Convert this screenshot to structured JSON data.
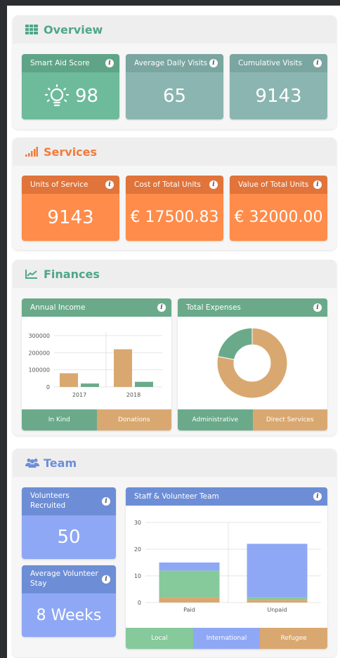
{
  "overview": {
    "title": "Overview",
    "cards": [
      {
        "label": "Smart Aid Score",
        "value": "98"
      },
      {
        "label": "Average Daily Visits",
        "value": "65"
      },
      {
        "label": "Cumulative Visits",
        "value": "9143"
      }
    ]
  },
  "services": {
    "title": "Services",
    "cards": [
      {
        "label": "Units of Service",
        "value": "9143"
      },
      {
        "label": "Cost of Total Units",
        "value": "€ 17500.83"
      },
      {
        "label": "Value of Total Units",
        "value": "€ 32000.00"
      }
    ]
  },
  "finances": {
    "title": "Finances",
    "income_label": "Annual Income",
    "expenses_label": "Total Expenses",
    "income_legend": [
      "In Kind",
      "Donations"
    ],
    "expenses_legend": [
      "Administrative",
      "Direct Services"
    ]
  },
  "team": {
    "title": "Team",
    "volunteers_label": "Volunteers Recruited",
    "volunteers_value": "50",
    "stay_label": "Average Volunteer Stay",
    "stay_value": "8 Weeks",
    "staff_label": "Staff & Volunteer Team",
    "staff_legend": [
      "Local",
      "International",
      "Refugee"
    ]
  },
  "colors": {
    "green": "#6aaa8a",
    "teal": "#8bb5b0",
    "orange": "#ff8c4a",
    "orange_dark": "#e57634",
    "tan": "#d9a870",
    "blue": "#8fa8f5",
    "blue_dark": "#6d8ed6",
    "mint": "#86c99b"
  },
  "chart_data": [
    {
      "type": "bar",
      "categories": [
        "2017",
        "2018"
      ],
      "series": [
        {
          "name": "In Kind",
          "values": [
            80000,
            220000
          ]
        },
        {
          "name": "Donations",
          "values": [
            20000,
            30000
          ]
        }
      ],
      "yticks": [
        0,
        100000,
        200000,
        300000
      ],
      "ylim": [
        0,
        320000
      ]
    },
    {
      "type": "pie",
      "donut": true,
      "labels": [
        "Administrative",
        "Direct Services"
      ],
      "values": [
        22,
        78
      ]
    },
    {
      "type": "bar",
      "stacked": true,
      "categories": [
        "Paid",
        "Unpaid"
      ],
      "series": [
        {
          "name": "Refugee",
          "values": [
            2,
            1
          ]
        },
        {
          "name": "Local",
          "values": [
            10,
            1
          ]
        },
        {
          "name": "International",
          "values": [
            3,
            20
          ]
        }
      ],
      "yticks": [
        0,
        10,
        20,
        30
      ],
      "ylim": [
        0,
        30
      ]
    }
  ]
}
